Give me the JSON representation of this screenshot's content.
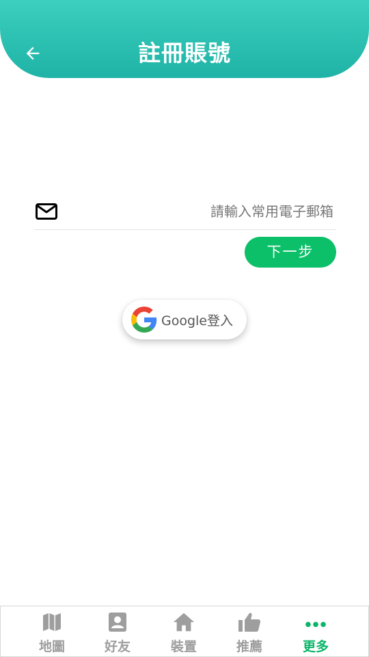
{
  "header": {
    "title": "註冊賬號",
    "back_icon": "arrow-left-icon"
  },
  "email": {
    "icon": "mail-icon",
    "placeholder": "請輸入常用電子郵箱",
    "value": ""
  },
  "next_button": {
    "label": "下一步",
    "color": "#0cbf69"
  },
  "google_button": {
    "icon": "google-icon",
    "label": "Google登入"
  },
  "bottom_nav": {
    "items": [
      {
        "label": "地圖",
        "icon": "map-icon",
        "active": false
      },
      {
        "label": "好友",
        "icon": "contact-icon",
        "active": false
      },
      {
        "label": "裝置",
        "icon": "home-icon",
        "active": false
      },
      {
        "label": "推薦",
        "icon": "thumbs-up-icon",
        "active": false
      },
      {
        "label": "更多",
        "icon": "more-icon",
        "active": true
      }
    ],
    "active_color": "#0cb56a",
    "inactive_color": "#9e9e9e"
  },
  "colors": {
    "header_top": "#3ccfbf",
    "header_bottom": "#1eb3a6"
  }
}
